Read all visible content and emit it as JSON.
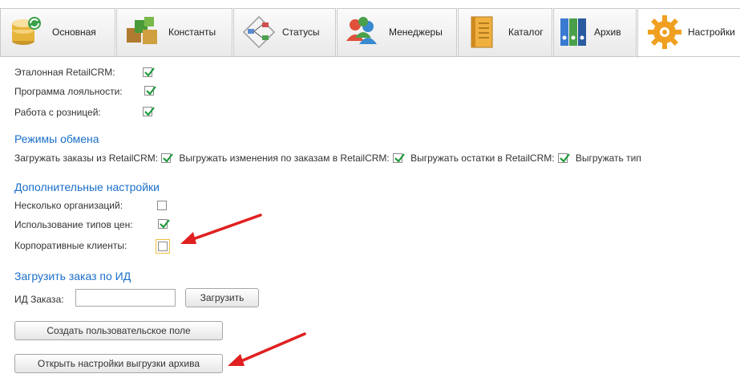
{
  "tabs": [
    {
      "label": "Основная",
      "icon": "database-icon"
    },
    {
      "label": "Константы",
      "icon": "blocks-icon"
    },
    {
      "label": "Статусы",
      "icon": "flowchart-icon"
    },
    {
      "label": "Менеджеры",
      "icon": "users-icon"
    },
    {
      "label": "Каталог",
      "icon": "catalog-icon"
    },
    {
      "label": "Архив",
      "icon": "binders-icon"
    },
    {
      "label": "Настройки",
      "icon": "gear-icon",
      "active": true
    }
  ],
  "general": {
    "reference": {
      "label": "Эталонная RetailCRM:",
      "checked": true
    },
    "loyalty": {
      "label": "Программа лояльности:",
      "checked": true
    },
    "retail": {
      "label": "Работа с розницей:",
      "checked": true
    }
  },
  "exchange": {
    "title": "Режимы обмена",
    "items": [
      {
        "label": "Загружать заказы  из RetailCRM:",
        "checked": true
      },
      {
        "label": "Выгружать изменения по заказам в RetailCRM:",
        "checked": true
      },
      {
        "label": "Выгружать остатки в RetailCRM:",
        "checked": true
      },
      {
        "label": "Выгружать тип",
        "checked": false
      }
    ]
  },
  "extra": {
    "title": "Дополнительные настройки",
    "multi_org": {
      "label": "Несколько организаций:",
      "checked": false
    },
    "price_types": {
      "label": "Использование типов цен:",
      "checked": true
    },
    "corporate": {
      "label": "Корпоративные клиенты:",
      "checked": false
    }
  },
  "load_order": {
    "title": "Загрузить заказ по ИД",
    "id_label": "ИД Заказа:",
    "id_value": "",
    "load_button": "Загрузить"
  },
  "buttons": {
    "create_field": "Создать пользовательское поле",
    "archive_settings": "Открыть настройки выгрузки архива"
  },
  "colors": {
    "accent": "#1a6fc9",
    "check": "#1f9a3a",
    "annotation": "#e02020"
  }
}
